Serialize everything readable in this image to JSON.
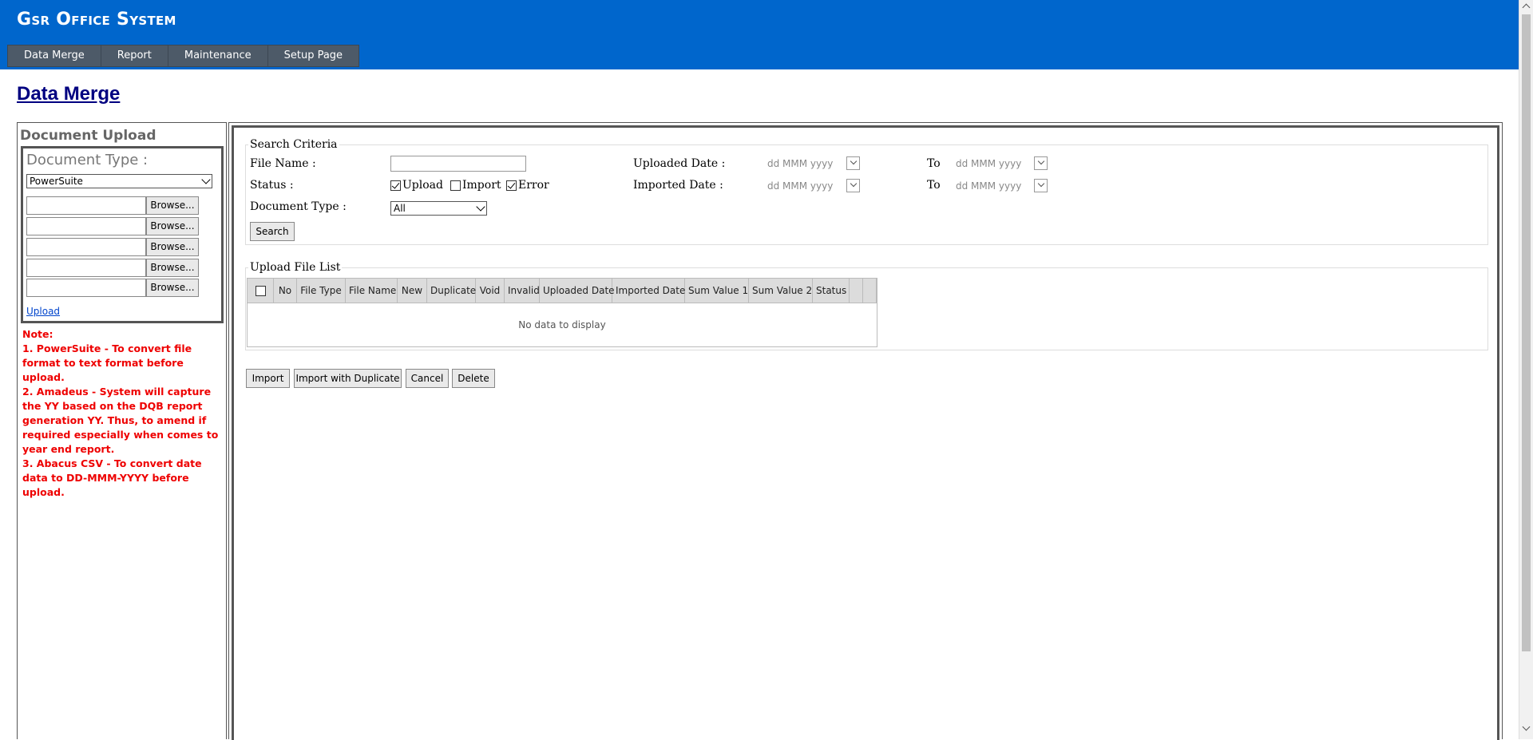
{
  "app": {
    "title": "Gsr Office System",
    "menu": [
      "Data Merge",
      "Report",
      "Maintenance",
      "Setup Page"
    ]
  },
  "page_title": "Data Merge",
  "left": {
    "section_title": "Document Upload",
    "doc_type_label": "Document Type :",
    "doc_type_value": "PowerSuite",
    "browse_label": "Browse...",
    "upload_link": "Upload",
    "note_title": "Note:",
    "notes": [
      "1. PowerSuite - To convert file format to text format before upload.",
      "2. Amadeus - System will capture the YY based on the DQB report generation YY. Thus, to amend if required especially when comes to year end report.",
      "3. Abacus CSV - To convert date data to DD-MMM-YYYY before upload."
    ]
  },
  "search": {
    "legend": "Search Criteria",
    "file_name_label": "File Name :",
    "status_label": "Status :",
    "status_options": [
      {
        "label": "Upload",
        "checked": true
      },
      {
        "label": "Import",
        "checked": false
      },
      {
        "label": "Error",
        "checked": true
      }
    ],
    "doc_type_label": "Document Type :",
    "doc_type_value": "All",
    "uploaded_date_label": "Uploaded Date :",
    "imported_date_label": "Imported Date :",
    "to_label": "To",
    "date_placeholder": "dd MMM yyyy",
    "search_button": "Search"
  },
  "file_list": {
    "legend": "Upload File List",
    "columns": [
      "No",
      "File Type",
      "File Name",
      "New",
      "Duplicate",
      "Void",
      "Invalid",
      "Uploaded Date",
      "Imported Date",
      "Sum Value 1",
      "Sum Value 2",
      "Status"
    ],
    "empty_text": "No data to display"
  },
  "actions": {
    "import": "Import",
    "import_dup": "Import with Duplicate",
    "cancel": "Cancel",
    "delete": "Delete"
  }
}
